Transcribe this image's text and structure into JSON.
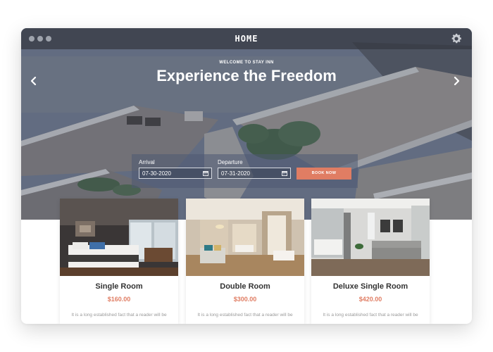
{
  "window": {
    "title": "HOME"
  },
  "hero": {
    "eyebrow": "WELCOME TO STAY INN",
    "headline": "Experience the Freedom"
  },
  "booking": {
    "arrival_label": "Arrival",
    "arrival_value": "07-30-2020",
    "departure_label": "Departure",
    "departure_value": "07-31-2020",
    "button_label": "BOOK NOW"
  },
  "rooms": [
    {
      "name": "Single Room",
      "price": "$160.00",
      "description": "It is a long established fact that a reader will be"
    },
    {
      "name": "Double Room",
      "price": "$300.00",
      "description": "It is a long established fact that a reader will be"
    },
    {
      "name": "Deluxe Single Room",
      "price": "$420.00",
      "description": "It is a long established fact that a reader will be"
    }
  ],
  "icons": {
    "window_controls": "window-dots-icon",
    "settings": "gear-icon",
    "prev": "chevron-left-icon",
    "next": "chevron-right-icon",
    "calendar": "calendar-icon"
  },
  "colors": {
    "accent": "#e07d63",
    "titlebar": "#343740",
    "heading": "#333333",
    "body_text": "#9a9a9a"
  }
}
